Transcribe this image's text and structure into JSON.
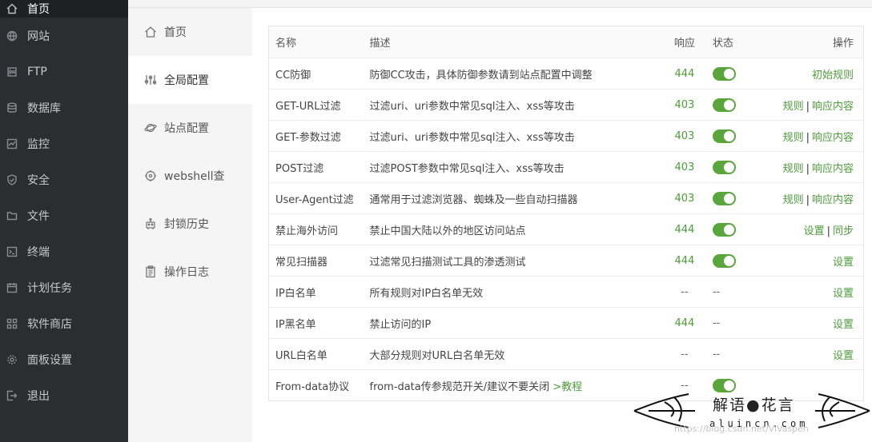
{
  "nav": {
    "items": [
      {
        "label": "首页",
        "icon": "home-icon",
        "active": true
      },
      {
        "label": "网站",
        "icon": "globe-icon"
      },
      {
        "label": "FTP",
        "icon": "ftp-icon"
      },
      {
        "label": "数据库",
        "icon": "database-icon"
      },
      {
        "label": "监控",
        "icon": "monitor-icon"
      },
      {
        "label": "安全",
        "icon": "shield-icon"
      },
      {
        "label": "文件",
        "icon": "folder-icon"
      },
      {
        "label": "终端",
        "icon": "terminal-icon"
      },
      {
        "label": "计划任务",
        "icon": "calendar-icon"
      },
      {
        "label": "软件商店",
        "icon": "grid-icon"
      },
      {
        "label": "面板设置",
        "icon": "gear-icon"
      },
      {
        "label": "退出",
        "icon": "logout-icon"
      }
    ]
  },
  "submenu": {
    "items": [
      {
        "label": "首页",
        "icon": "home-icon"
      },
      {
        "label": "全局配置",
        "icon": "sliders-icon",
        "active": true
      },
      {
        "label": "站点配置",
        "icon": "planet-icon"
      },
      {
        "label": "webshell查",
        "icon": "target-icon"
      },
      {
        "label": "封锁历史",
        "icon": "robot-icon"
      },
      {
        "label": "操作日志",
        "icon": "clipboard-icon"
      }
    ]
  },
  "table": {
    "headers": {
      "name": "名称",
      "desc": "描述",
      "code": "响应",
      "state": "状态",
      "op": "操作"
    },
    "rows": [
      {
        "name": "CC防御",
        "desc": "防御CC攻击，具体防御参数请到站点配置中调整",
        "code": "444",
        "state": "on",
        "ops": [
          "初始规则"
        ]
      },
      {
        "name": "GET-URL过滤",
        "desc": "过滤uri、uri参数中常见sql注入、xss等攻击",
        "code": "403",
        "state": "on",
        "ops": [
          "规则",
          "响应内容"
        ]
      },
      {
        "name": "GET-参数过滤",
        "desc": "过滤uri、uri参数中常见sql注入、xss等攻击",
        "code": "403",
        "state": "on",
        "ops": [
          "规则",
          "响应内容"
        ]
      },
      {
        "name": "POST过滤",
        "desc": "过滤POST参数中常见sql注入、xss等攻击",
        "code": "403",
        "state": "on",
        "ops": [
          "规则",
          "响应内容"
        ]
      },
      {
        "name": "User-Agent过滤",
        "desc": "通常用于过滤浏览器、蜘蛛及一些自动扫描器",
        "code": "403",
        "state": "on",
        "ops": [
          "规则",
          "响应内容"
        ]
      },
      {
        "name": "禁止海外访问",
        "desc": "禁止中国大陆以外的地区访问站点",
        "code": "444",
        "state": "on",
        "ops": [
          "设置",
          "同步"
        ]
      },
      {
        "name": "常见扫描器",
        "desc": "过滤常见扫描测试工具的渗透测试",
        "code": "444",
        "state": "on",
        "ops": [
          "设置"
        ]
      },
      {
        "name": "IP白名单",
        "desc": "所有规则对IP白名单无效",
        "code": "--",
        "state": "--",
        "ops": [
          "设置"
        ]
      },
      {
        "name": "IP黑名单",
        "desc": "禁止访问的IP",
        "code": "444",
        "state": "--",
        "ops": [
          "设置"
        ]
      },
      {
        "name": "URL白名单",
        "desc": "大部分规则对URL白名单无效",
        "code": "--",
        "state": "--",
        "ops": [
          "设置"
        ]
      },
      {
        "name": "From-data协议",
        "desc": "from-data传参规范开关/建议不要关闭",
        "desc_link": ">教程",
        "code": "--",
        "state": "on",
        "ops": []
      }
    ]
  },
  "watermark": {
    "title": "解语●花言",
    "subtitle": "aluincn.com",
    "url": "https://blog.csdn.net/ViVaspen"
  },
  "colors": {
    "accent": "#4d9c3a",
    "toggle_on": "#5aa63d",
    "nav_bg": "#2b2d30"
  }
}
